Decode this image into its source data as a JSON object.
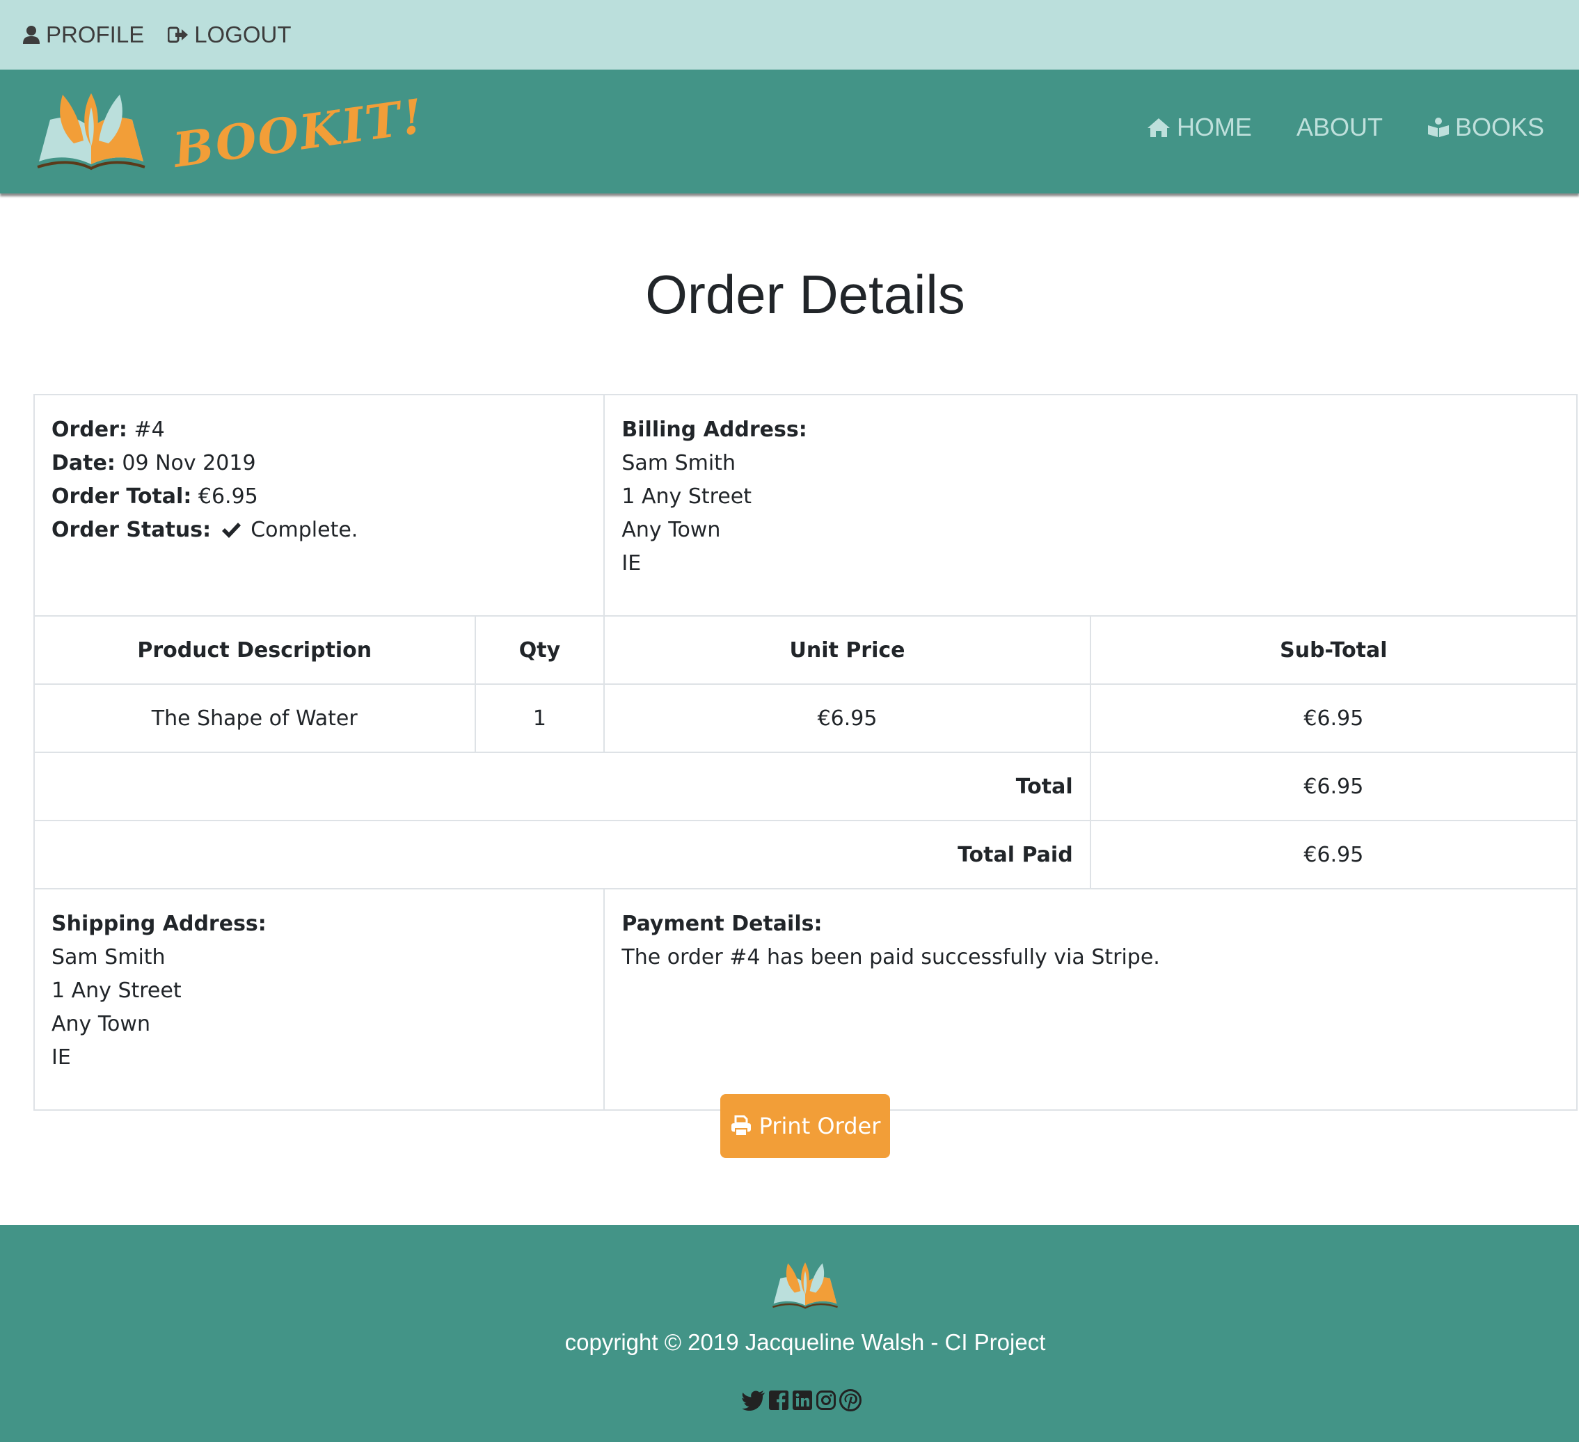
{
  "topbar": {
    "profile_label": "PROFILE",
    "logout_label": "LOGOUT"
  },
  "brand": {
    "name": "BOOKIT!"
  },
  "nav": {
    "home_label": "HOME",
    "about_label": "ABOUT",
    "books_label": "BOOKS"
  },
  "page": {
    "title": "Order Details"
  },
  "order": {
    "order_label": "Order:",
    "order_value": "#4",
    "date_label": "Date:",
    "date_value": "09 Nov 2019",
    "total_label": "Order Total:",
    "total_value": "€6.95",
    "status_label": "Order Status:",
    "status_value": "Complete."
  },
  "billing": {
    "label": "Billing Address:",
    "name": "Sam Smith",
    "street": "1 Any Street",
    "town": "Any Town",
    "country": "IE"
  },
  "table": {
    "headers": [
      "Product Description",
      "Qty",
      "Unit Price",
      "Sub-Total"
    ],
    "rows": [
      {
        "description": "The Shape of Water",
        "qty": "1",
        "unit_price": "€6.95",
        "subtotal": "€6.95"
      }
    ],
    "total_label": "Total",
    "total_value": "€6.95",
    "total_paid_label": "Total Paid",
    "total_paid_value": "€6.95"
  },
  "shipping": {
    "label": "Shipping Address:",
    "name": "Sam Smith",
    "street": "1 Any Street",
    "town": "Any Town",
    "country": "IE"
  },
  "payment": {
    "label": "Payment Details:",
    "text": "The order #4 has been paid successfully via Stripe."
  },
  "actions": {
    "print_label": "Print Order"
  },
  "footer": {
    "copyright": "copyright © 2019 Jacqueline Walsh - CI Project",
    "social_icons": [
      "twitter-icon",
      "facebook-icon",
      "linkedin-icon",
      "instagram-icon",
      "pinterest-icon"
    ]
  },
  "colors": {
    "topbar_bg": "#bbdfdc",
    "navbar_bg": "#439487",
    "brand_orange": "#f29e38",
    "nav_link": "#bfe0dc",
    "button_bg": "#f29e38"
  }
}
